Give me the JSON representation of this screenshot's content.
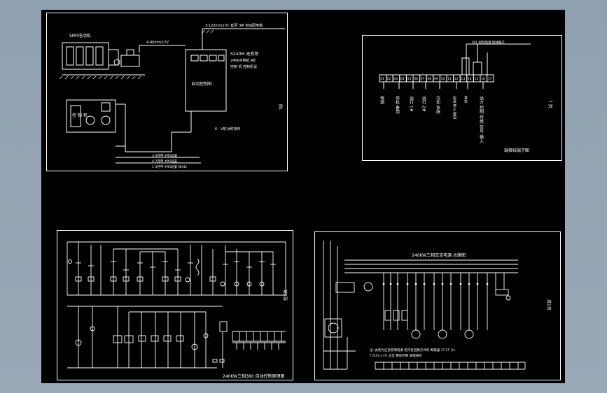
{
  "sheets": {
    "s1": {
      "motor_label": "SM0电动机",
      "cable_top": "3-120mm2-YC 延至 3# 自动配电箱",
      "cable_mid": "4-90mm2-YV",
      "panel_label": "自动控制柜",
      "spec_1": "S240M 无变频",
      "spec_2": "240kW电机 AB",
      "spec_3": "控制 机 控制柜设",
      "cab_text": "控 制 柜",
      "note": "6 · V形对称排布",
      "wire_1": "3-3月甲 #95延安",
      "wire_2": "4-7月甲 #95延安",
      "wire_3": "1-3月甲 #95延安 NH41",
      "side": "图1"
    },
    "s2": {
      "top_note": "SPL 控制电源 接线端子",
      "terminals": [
        "01",
        "02",
        "03",
        "04",
        "05",
        "06",
        "07",
        "08",
        "09",
        "10",
        "11",
        "12",
        "13",
        "14",
        "15",
        "16",
        "17"
      ],
      "labels": [
        "电源",
        "停机 备用",
        "运行 1#",
        "运行 2#",
        "冷却 系统",
        "应急 停止 按钮",
        "复位",
        "远方 控制 传感 信号 输入"
      ],
      "title": "端接线端子图",
      "side": "7 页"
    },
    "s3": {
      "title": "240KW三相380 自动控制原理图",
      "side": "控2页"
    },
    "s4": {
      "title": "240KW三相交流电源 总路图",
      "note_1": "注: 此柜为应急照明电源 柜内各回路元件的 断路器 1T-1T (1)",
      "note_2": "7.5(F)-1 (T) 应急 整体控制 联锁保护",
      "side": "说1页"
    }
  }
}
